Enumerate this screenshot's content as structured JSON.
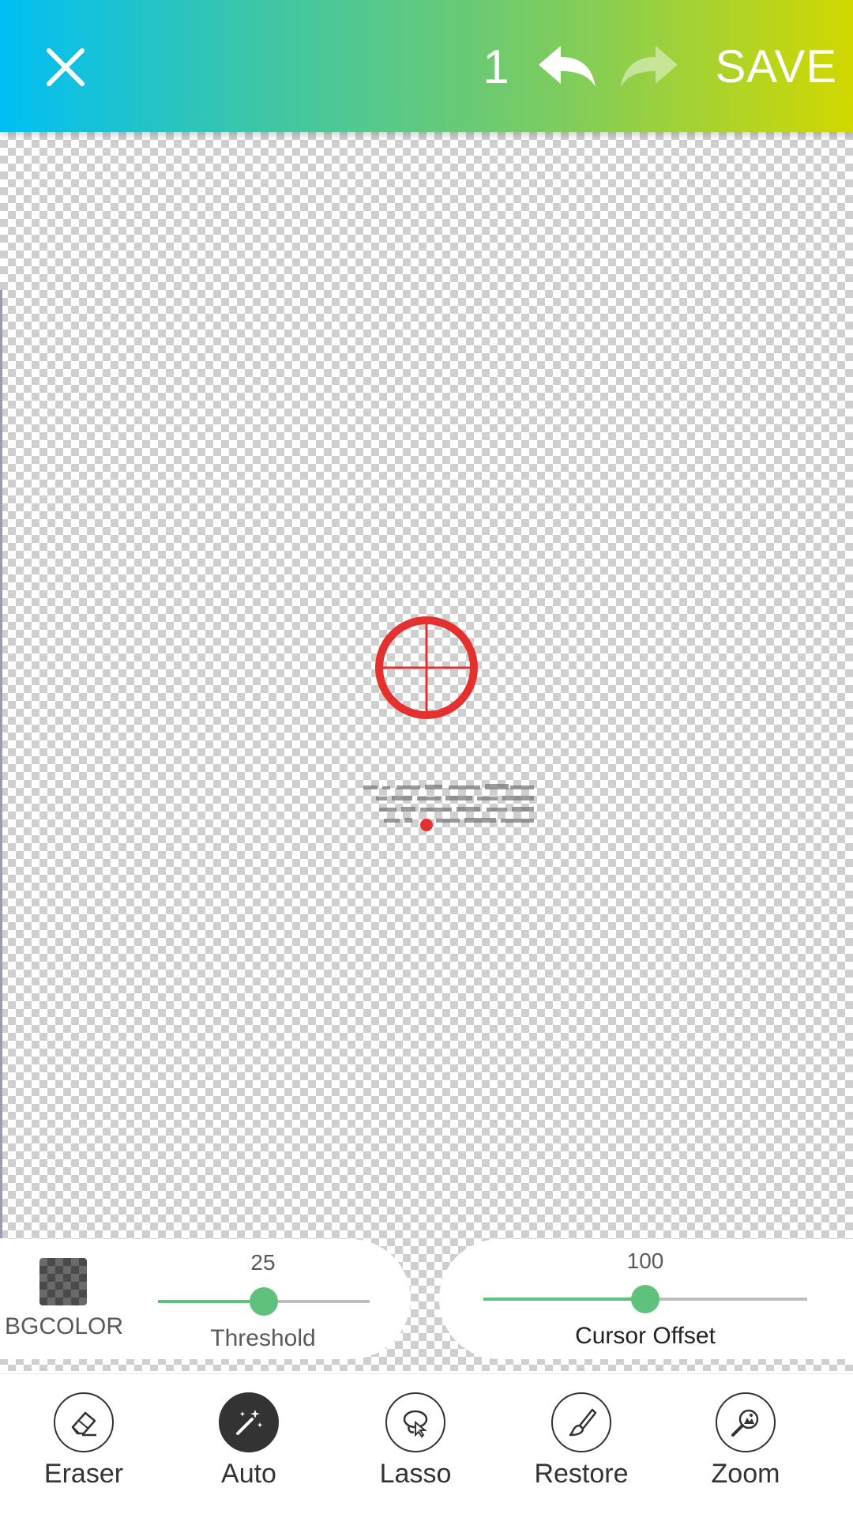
{
  "topbar": {
    "undo_count": "1",
    "save_label": "SAVE",
    "icons": [
      "close-icon",
      "undo-icon",
      "redo-icon"
    ],
    "gradient": [
      "#00bff5",
      "#3cc6a8",
      "#7ccc60",
      "#d2d800"
    ]
  },
  "controls": {
    "bgcolor_label": "BGCOLOR",
    "threshold": {
      "value": "25",
      "label": "Threshold",
      "fraction": 0.5
    },
    "cursor_offset": {
      "value": "100",
      "label": "Cursor Offset",
      "fraction": 0.5
    }
  },
  "tools": [
    {
      "label": "Eraser",
      "icon": "eraser-icon",
      "active": false
    },
    {
      "label": "Auto",
      "icon": "magic-wand-icon",
      "active": true
    },
    {
      "label": "Lasso",
      "icon": "lasso-icon",
      "active": false
    },
    {
      "label": "Restore",
      "icon": "brush-icon",
      "active": false
    },
    {
      "label": "Zoom",
      "icon": "zoom-icon",
      "active": false
    }
  ],
  "colors": {
    "accent": "#5fc27c",
    "target": "#e53030"
  }
}
